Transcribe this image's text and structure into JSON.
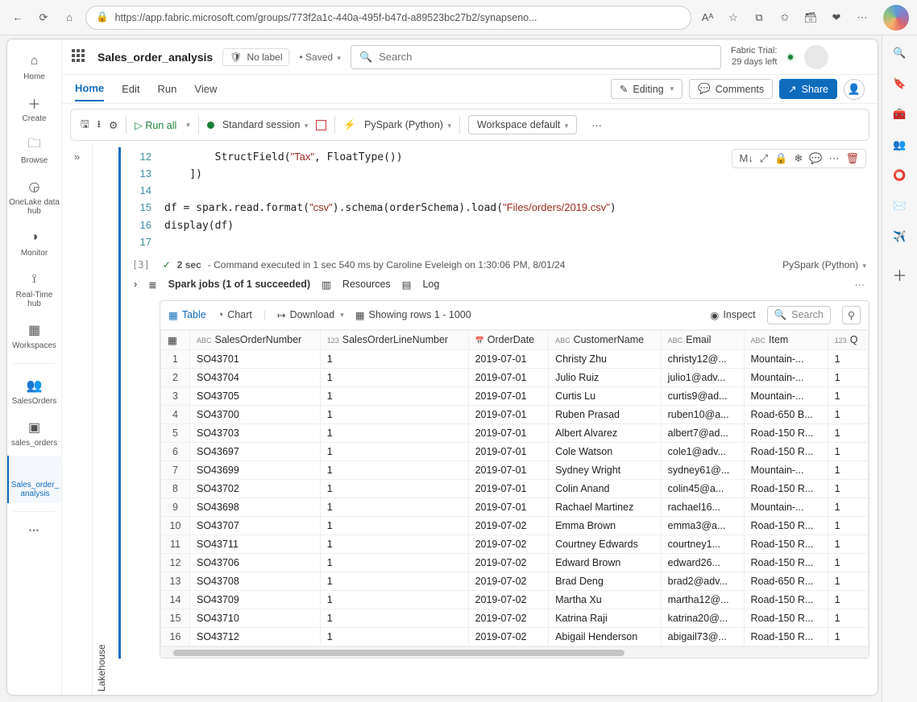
{
  "browser": {
    "url": "https://app.fabric.microsoft.com/groups/773f2a1c-440a-495f-b47d-a89523bc27b2/synapseno...",
    "aa_icon": "Aᴬ"
  },
  "right_rail_icons": [
    "🔍",
    "🔖",
    "🧰",
    "👥",
    "⭕",
    "✉️",
    "✈️"
  ],
  "left_rail": [
    {
      "icon": "⌂",
      "label": "Home"
    },
    {
      "icon": "＋",
      "label": "Create"
    },
    {
      "icon": "🗀",
      "label": "Browse"
    },
    {
      "icon": "◶",
      "label": "OneLake data hub"
    },
    {
      "icon": "◑",
      "label": "Monitor"
    },
    {
      "icon": "⟟",
      "label": "Real-Time hub"
    },
    {
      "icon": "▦",
      "label": "Workspaces"
    },
    {
      "icon": "👥",
      "label": "SalesOrders"
    },
    {
      "icon": "▣",
      "label": "sales_orders"
    },
    {
      "icon": "</>",
      "label": "Sales_order_\nanalysis",
      "active": true
    }
  ],
  "title_row": {
    "name": "Sales_order_analysis",
    "sensitivity": "No label",
    "saved": "Saved",
    "search_placeholder": "Search",
    "trial_line1": "Fabric Trial:",
    "trial_line2": "29 days left"
  },
  "menu": {
    "tabs": [
      "Home",
      "Edit",
      "Run",
      "View"
    ],
    "editing": "Editing",
    "comments": "Comments",
    "share": "Share"
  },
  "toolbar": {
    "run_all": "Run all",
    "session": "Standard session",
    "lang": "PySpark (Python)",
    "ws": "Workspace default"
  },
  "lakehouse_label": "Lakehouse",
  "code_lines": [
    {
      "n": 12,
      "t": "        StructField(\"Tax\", FloatType())",
      "colorized": true
    },
    {
      "n": 13,
      "t": "    ])"
    },
    {
      "n": 14,
      "t": ""
    },
    {
      "n": 15,
      "t": "df = spark.read.format(\"csv\").schema(orderSchema).load(\"Files/orders/2019.csv\")",
      "colorized": true
    },
    {
      "n": 16,
      "t": "display(df)"
    },
    {
      "n": 17,
      "t": ""
    }
  ],
  "exec": {
    "index": "[3]",
    "duration": "2 sec",
    "status": "Command executed in 1 sec 540 ms by Caroline Eveleigh on 1:30:06 PM, 8/01/24",
    "lang": "PySpark (Python)"
  },
  "jobs": {
    "text": "Spark jobs (1 of 1 succeeded)",
    "resources": "Resources",
    "log": "Log"
  },
  "result_toolbar": {
    "table": "Table",
    "chart": "Chart",
    "download": "Download",
    "rows": "Showing rows 1 - 1000",
    "inspect": "Inspect",
    "search_placeholder": "Search"
  },
  "columns": [
    {
      "t": "ABC",
      "n": "SalesOrderNumber"
    },
    {
      "t": "123",
      "n": "SalesOrderLineNumber"
    },
    {
      "t": "📅",
      "n": "OrderDate"
    },
    {
      "t": "ABC",
      "n": "CustomerName"
    },
    {
      "t": "ABC",
      "n": "Email"
    },
    {
      "t": "ABC",
      "n": "Item"
    },
    {
      "t": "123",
      "n": "Q"
    }
  ],
  "rows": [
    [
      "1",
      "SO43701",
      "1",
      "2019-07-01",
      "Christy Zhu",
      "christy12@...",
      "Mountain-...",
      "1"
    ],
    [
      "2",
      "SO43704",
      "1",
      "2019-07-01",
      "Julio Ruiz",
      "julio1@adv...",
      "Mountain-...",
      "1"
    ],
    [
      "3",
      "SO43705",
      "1",
      "2019-07-01",
      "Curtis Lu",
      "curtis9@ad...",
      "Mountain-...",
      "1"
    ],
    [
      "4",
      "SO43700",
      "1",
      "2019-07-01",
      "Ruben Prasad",
      "ruben10@a...",
      "Road-650 B...",
      "1"
    ],
    [
      "5",
      "SO43703",
      "1",
      "2019-07-01",
      "Albert Alvarez",
      "albert7@ad...",
      "Road-150 R...",
      "1"
    ],
    [
      "6",
      "SO43697",
      "1",
      "2019-07-01",
      "Cole Watson",
      "cole1@adv...",
      "Road-150 R...",
      "1"
    ],
    [
      "7",
      "SO43699",
      "1",
      "2019-07-01",
      "Sydney Wright",
      "sydney61@...",
      "Mountain-...",
      "1"
    ],
    [
      "8",
      "SO43702",
      "1",
      "2019-07-01",
      "Colin Anand",
      "colin45@a...",
      "Road-150 R...",
      "1"
    ],
    [
      "9",
      "SO43698",
      "1",
      "2019-07-01",
      "Rachael Martinez",
      "rachael16...",
      "Mountain-...",
      "1"
    ],
    [
      "10",
      "SO43707",
      "1",
      "2019-07-02",
      "Emma Brown",
      "emma3@a...",
      "Road-150 R...",
      "1"
    ],
    [
      "11",
      "SO43711",
      "1",
      "2019-07-02",
      "Courtney Edwards",
      "courtney1...",
      "Road-150 R...",
      "1"
    ],
    [
      "12",
      "SO43706",
      "1",
      "2019-07-02",
      "Edward Brown",
      "edward26...",
      "Road-150 R...",
      "1"
    ],
    [
      "13",
      "SO43708",
      "1",
      "2019-07-02",
      "Brad Deng",
      "brad2@adv...",
      "Road-650 R...",
      "1"
    ],
    [
      "14",
      "SO43709",
      "1",
      "2019-07-02",
      "Martha Xu",
      "martha12@...",
      "Road-150 R...",
      "1"
    ],
    [
      "15",
      "SO43710",
      "1",
      "2019-07-02",
      "Katrina Raji",
      "katrina20@...",
      "Road-150 R...",
      "1"
    ],
    [
      "16",
      "SO43712",
      "1",
      "2019-07-02",
      "Abigail Henderson",
      "abigail73@...",
      "Road-150 R...",
      "1"
    ]
  ]
}
